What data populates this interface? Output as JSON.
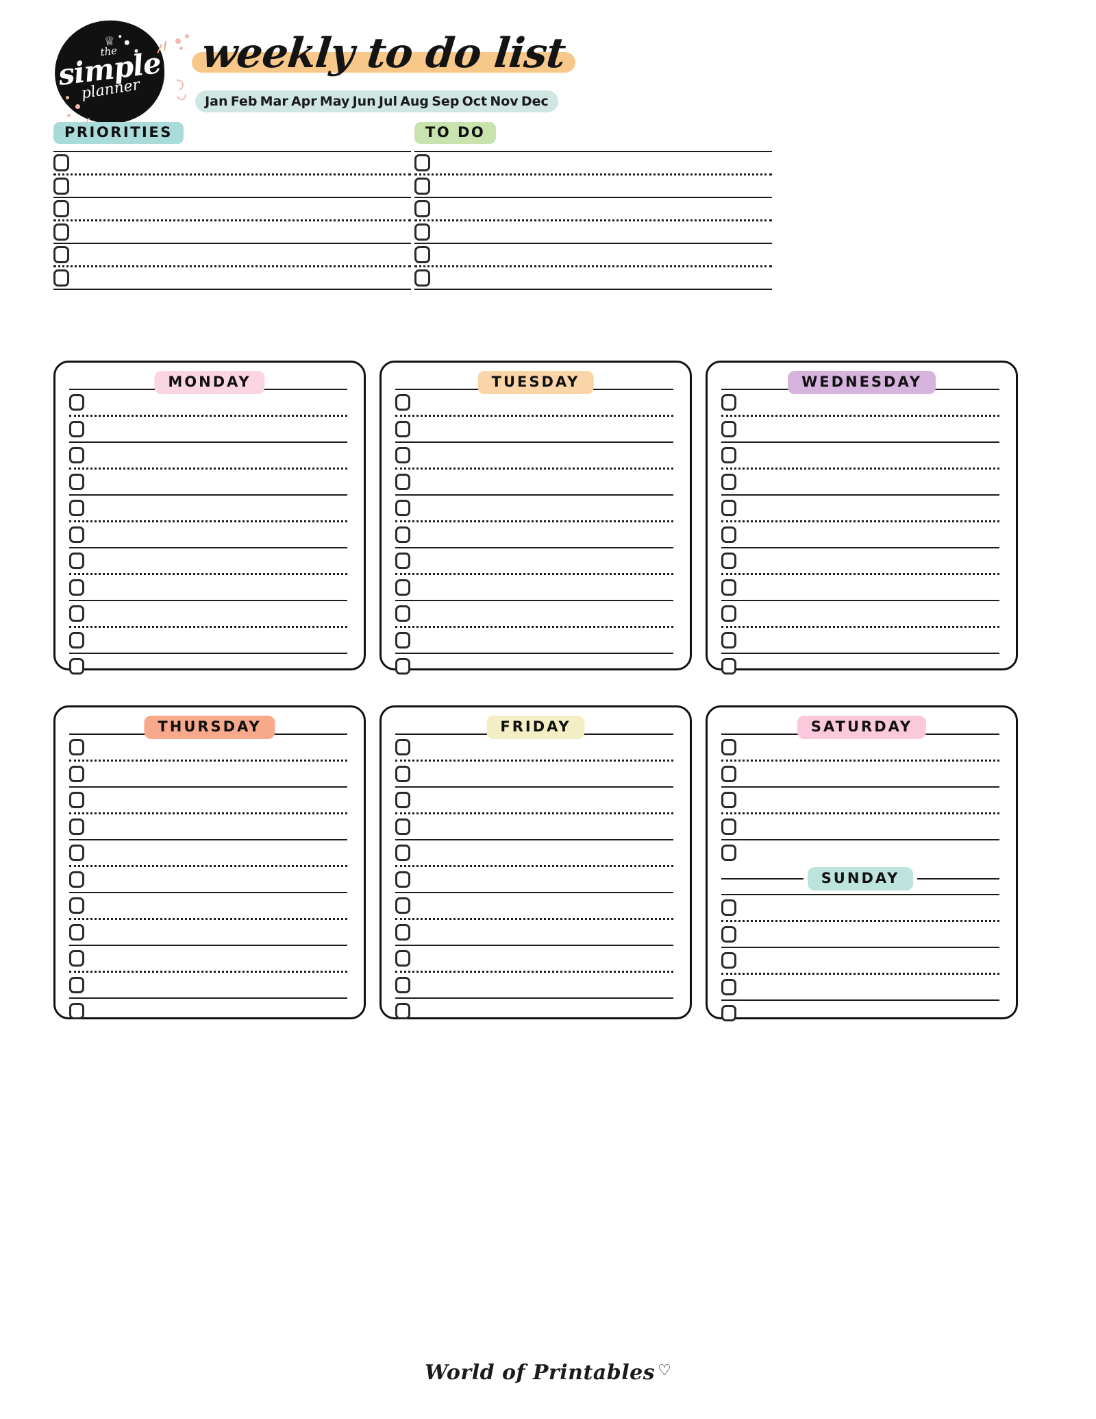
{
  "brand": {
    "logo_line1": "the",
    "logo_line2": "simple",
    "logo_line3": "planner",
    "crown_icon": "crown-icon"
  },
  "header": {
    "title": "weekly to do list",
    "highlight_color": "#f8c88a",
    "months_bar_color": "#cfe6e3",
    "months": [
      "Jan",
      "Feb",
      "Mar",
      "Apr",
      "May",
      "Jun",
      "Jul",
      "Aug",
      "Sep",
      "Oct",
      "Nov",
      "Dec"
    ]
  },
  "sections": {
    "priorities": {
      "label": "PRIORITIES",
      "badge_color": "#a9dbd8",
      "row_count": 6,
      "rows": [
        {
          "separator": "solid"
        },
        {
          "separator": "dotted"
        },
        {
          "separator": "solid"
        },
        {
          "separator": "dotted"
        },
        {
          "separator": "solid"
        },
        {
          "separator": "dotted"
        },
        {
          "separator": "solid"
        }
      ]
    },
    "todo": {
      "label": "TO DO",
      "badge_color": "#c9e3ae",
      "row_count": 6,
      "rows": [
        {
          "separator": "solid"
        },
        {
          "separator": "dotted"
        },
        {
          "separator": "solid"
        },
        {
          "separator": "dotted"
        },
        {
          "separator": "solid"
        },
        {
          "separator": "dotted"
        },
        {
          "separator": "solid"
        }
      ]
    }
  },
  "days": [
    {
      "label": "MONDAY",
      "badge_color": "#fbd6e2",
      "row_count": 11
    },
    {
      "label": "TUESDAY",
      "badge_color": "#f9d5a7",
      "row_count": 11
    },
    {
      "label": "WEDNESDAY",
      "badge_color": "#d7b4de",
      "row_count": 11
    },
    {
      "label": "THURSDAY",
      "badge_color": "#f8a98c",
      "row_count": 11
    },
    {
      "label": "FRIDAY",
      "badge_color": "#f4eec4",
      "row_count": 11
    },
    {
      "label": "SATURDAY",
      "badge_color": "#fbc8dc",
      "row_count": 5
    },
    {
      "label": "SUNDAY",
      "badge_color": "#bde3dd",
      "row_count": 5
    }
  ],
  "footer": {
    "text": "World of Printables",
    "heart_icon": "♡"
  }
}
